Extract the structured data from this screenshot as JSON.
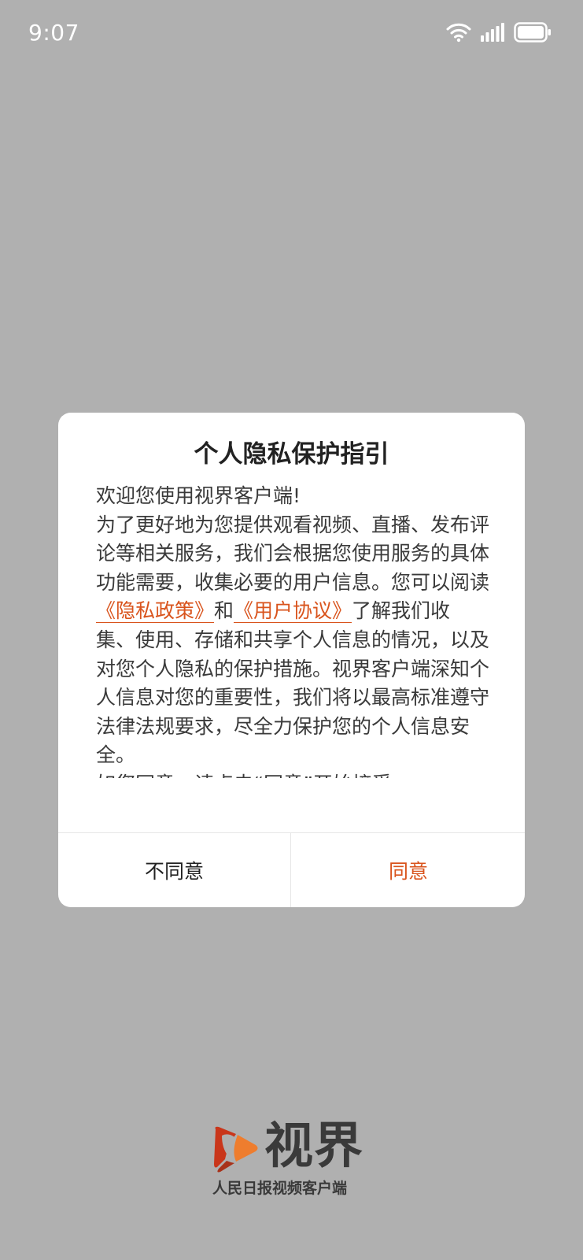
{
  "status_bar": {
    "time": "9:07"
  },
  "dialog": {
    "title": "个人隐私保护指引",
    "body": {
      "welcome": "欢迎您使用视界客户端!",
      "intro": "为了更好地为您提供观看视频、直播、发布评论等相关服务，我们会根据您使用服务的具体功能需要，收集必要的用户信息。您可以阅读",
      "privacy_link": "《隐私政策》",
      "conjunction": "和",
      "agreement_link": "《用户协议》",
      "detail": "了解我们收集、使用、存储和共享个人信息的情况，以及对您个人隐私的保护措施。视界客户端深知个人信息对您的重要性，我们将以最高标准遵守法律法规要求，尽全力保护您的个人信息安全。",
      "prompt": "如您同意，请点击“同意”开始接受"
    },
    "disagree_label": "不同意",
    "agree_label": "同意"
  },
  "brand": {
    "name": "视界",
    "slogan": "人民日报视频客户端"
  },
  "colors": {
    "accent": "#d9541d",
    "overlay": "#b0b0b0",
    "logo_red": "#c9361b",
    "logo_orange": "#ee7d2e"
  }
}
